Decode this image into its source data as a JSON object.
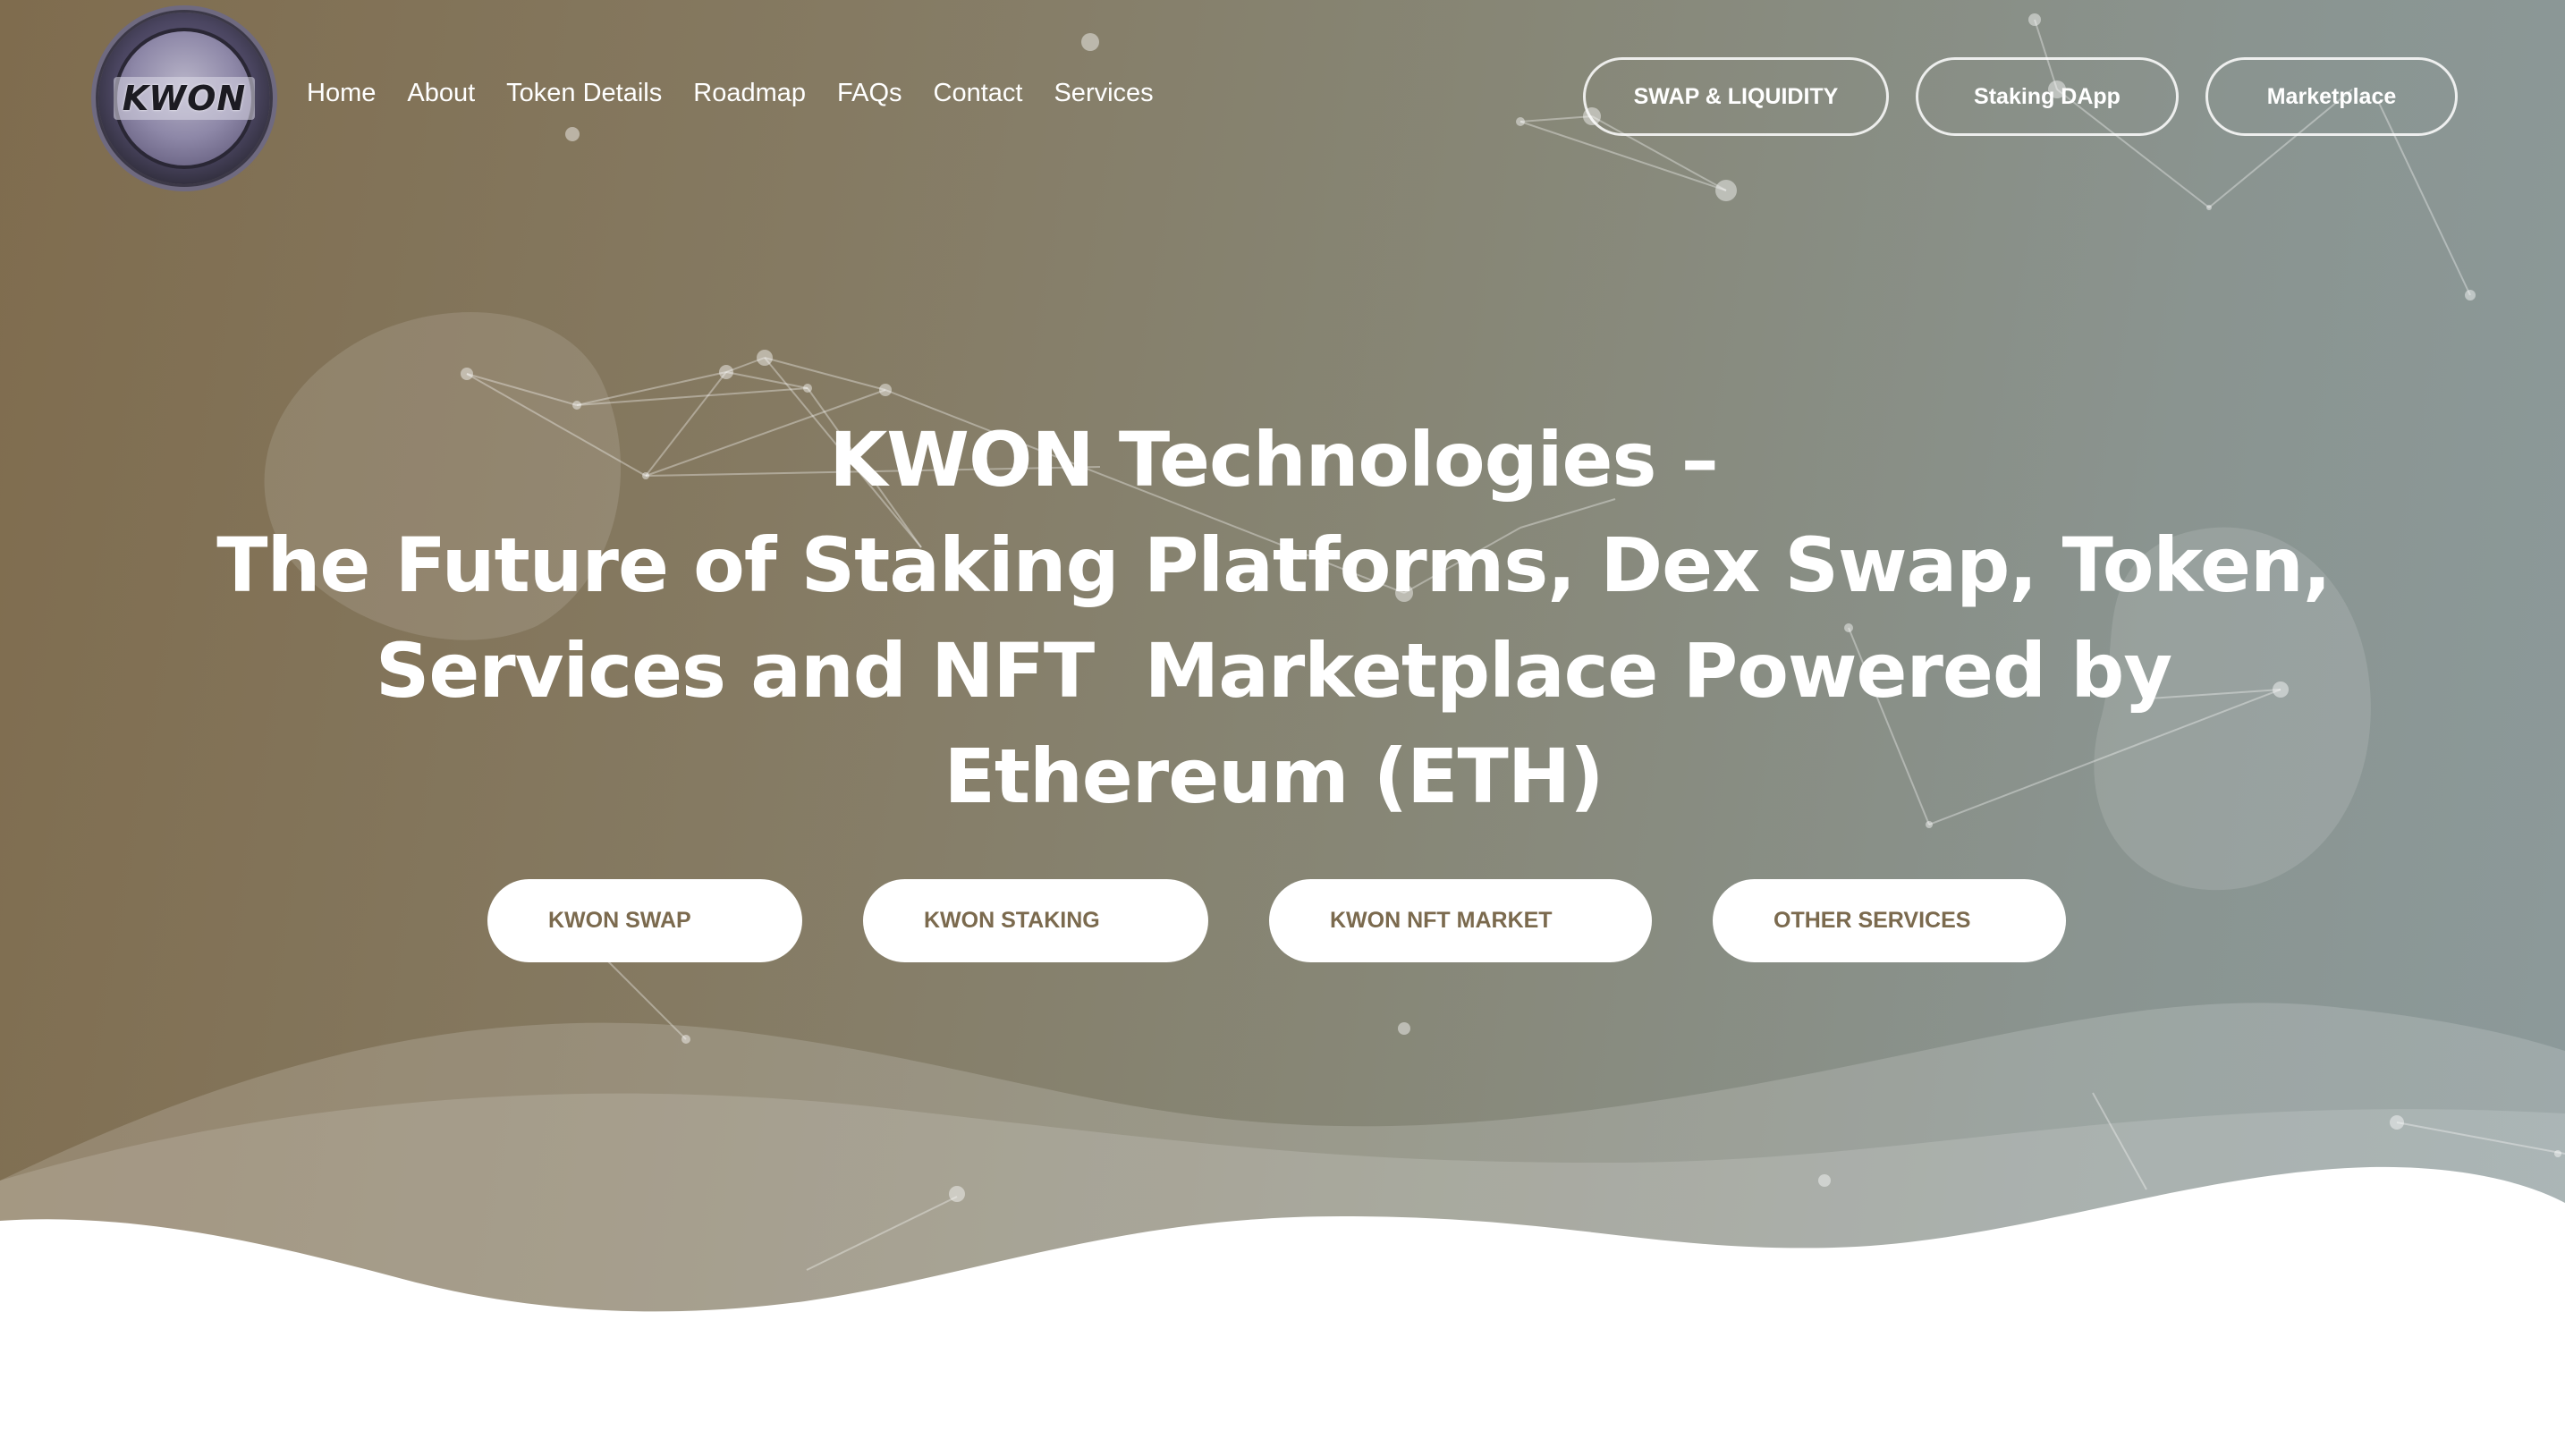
{
  "brand": {
    "logo_text": "KWON"
  },
  "nav": {
    "items": [
      "Home",
      "About",
      "Token Details",
      "Roadmap",
      "FAQs",
      "Contact",
      "Services"
    ]
  },
  "header_buttons": {
    "swap": "SWAP & LIQUIDITY",
    "staking": "Staking DApp",
    "marketplace": "Marketplace"
  },
  "hero": {
    "title_line1": "KWON Technologies –",
    "title_line2": "The Future of Staking Platforms, Dex Swap, Token,",
    "title_line3": "Services and NFT  Marketplace Powered by",
    "title_line4": "Ethereum (ETH)"
  },
  "cta_buttons": {
    "swap": "KWON SWAP",
    "staking": "KWON STAKING",
    "nft": "KWON NFT MARKET",
    "other": "OTHER SERVICES"
  },
  "colors": {
    "gradient_left": "#7f6c4e",
    "gradient_right": "#8c9a9b",
    "cta_text": "#7b6a4e",
    "white": "#ffffff"
  }
}
